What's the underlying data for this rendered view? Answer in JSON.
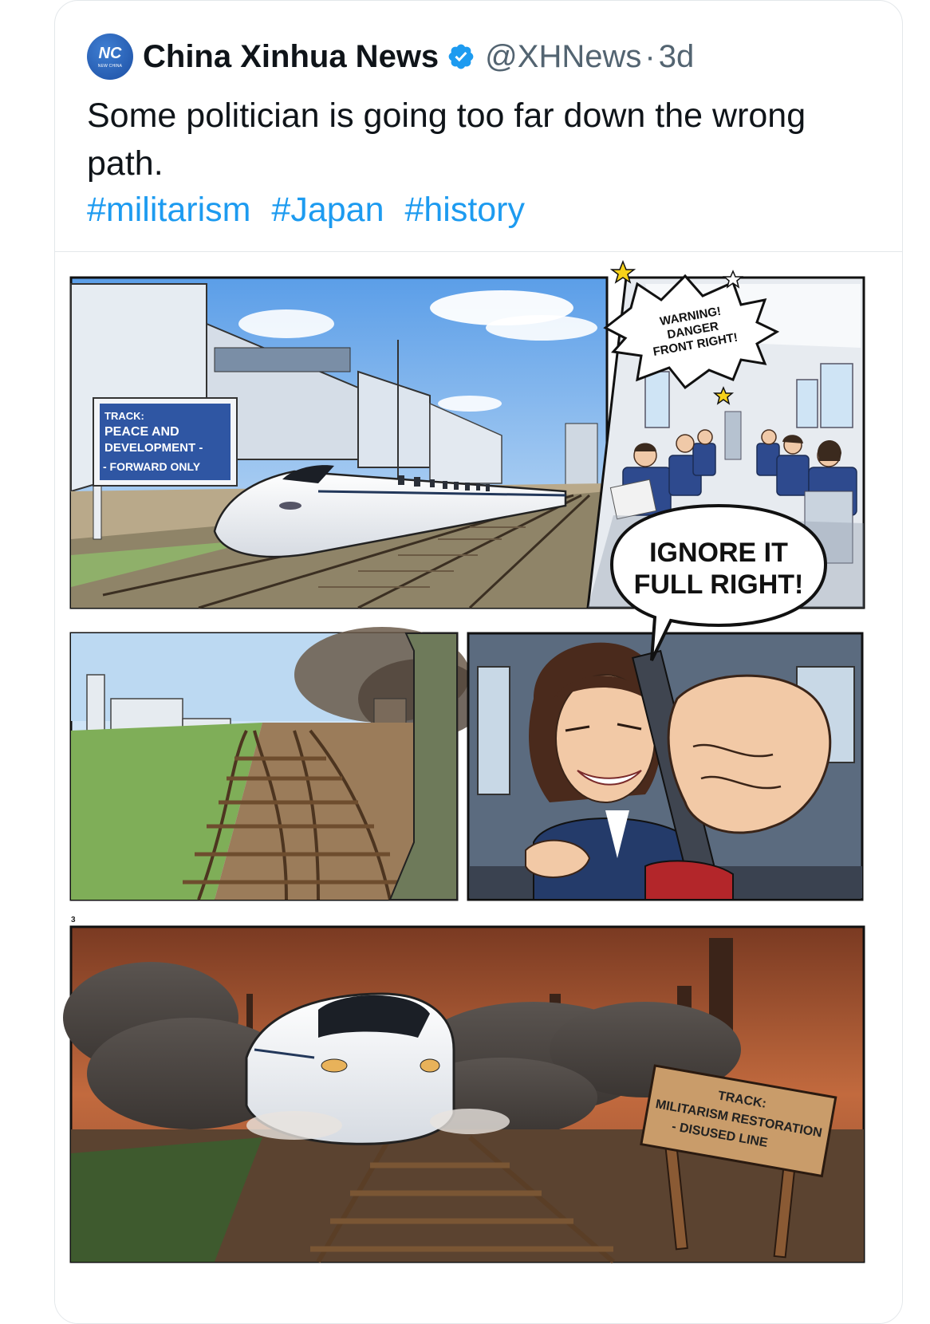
{
  "post": {
    "author_name": "China Xinhua News",
    "handle": "@XHNews",
    "separator": "·",
    "time": "3d",
    "avatar_logo": "NC",
    "avatar_sub": "NEW CHINA",
    "text": "Some politician is going too far down the wrong path.",
    "hashtags": [
      "#militarism",
      "#Japan",
      "#history"
    ]
  },
  "comic": {
    "sign1_lines": [
      "TRACK:",
      "PEACE AND",
      "DEVELOPMENT -",
      "- FORWARD ONLY"
    ],
    "warning_lines": [
      "WARNING!",
      "DANGER",
      "FRONT RIGHT!"
    ],
    "speech_lines": [
      "IGNORE IT",
      "FULL RIGHT!"
    ],
    "panel_number": "3",
    "sign2_lines": [
      "TRACK:",
      "MILITARISM RESTORATION",
      "- DISUSED LINE"
    ]
  },
  "colors": {
    "verified": "#1d9bf0",
    "hashtag": "#1d9bf0",
    "text": "#0f1419",
    "muted": "#536471"
  },
  "icons": [
    "verified-badge-icon",
    "avatar-logo"
  ]
}
